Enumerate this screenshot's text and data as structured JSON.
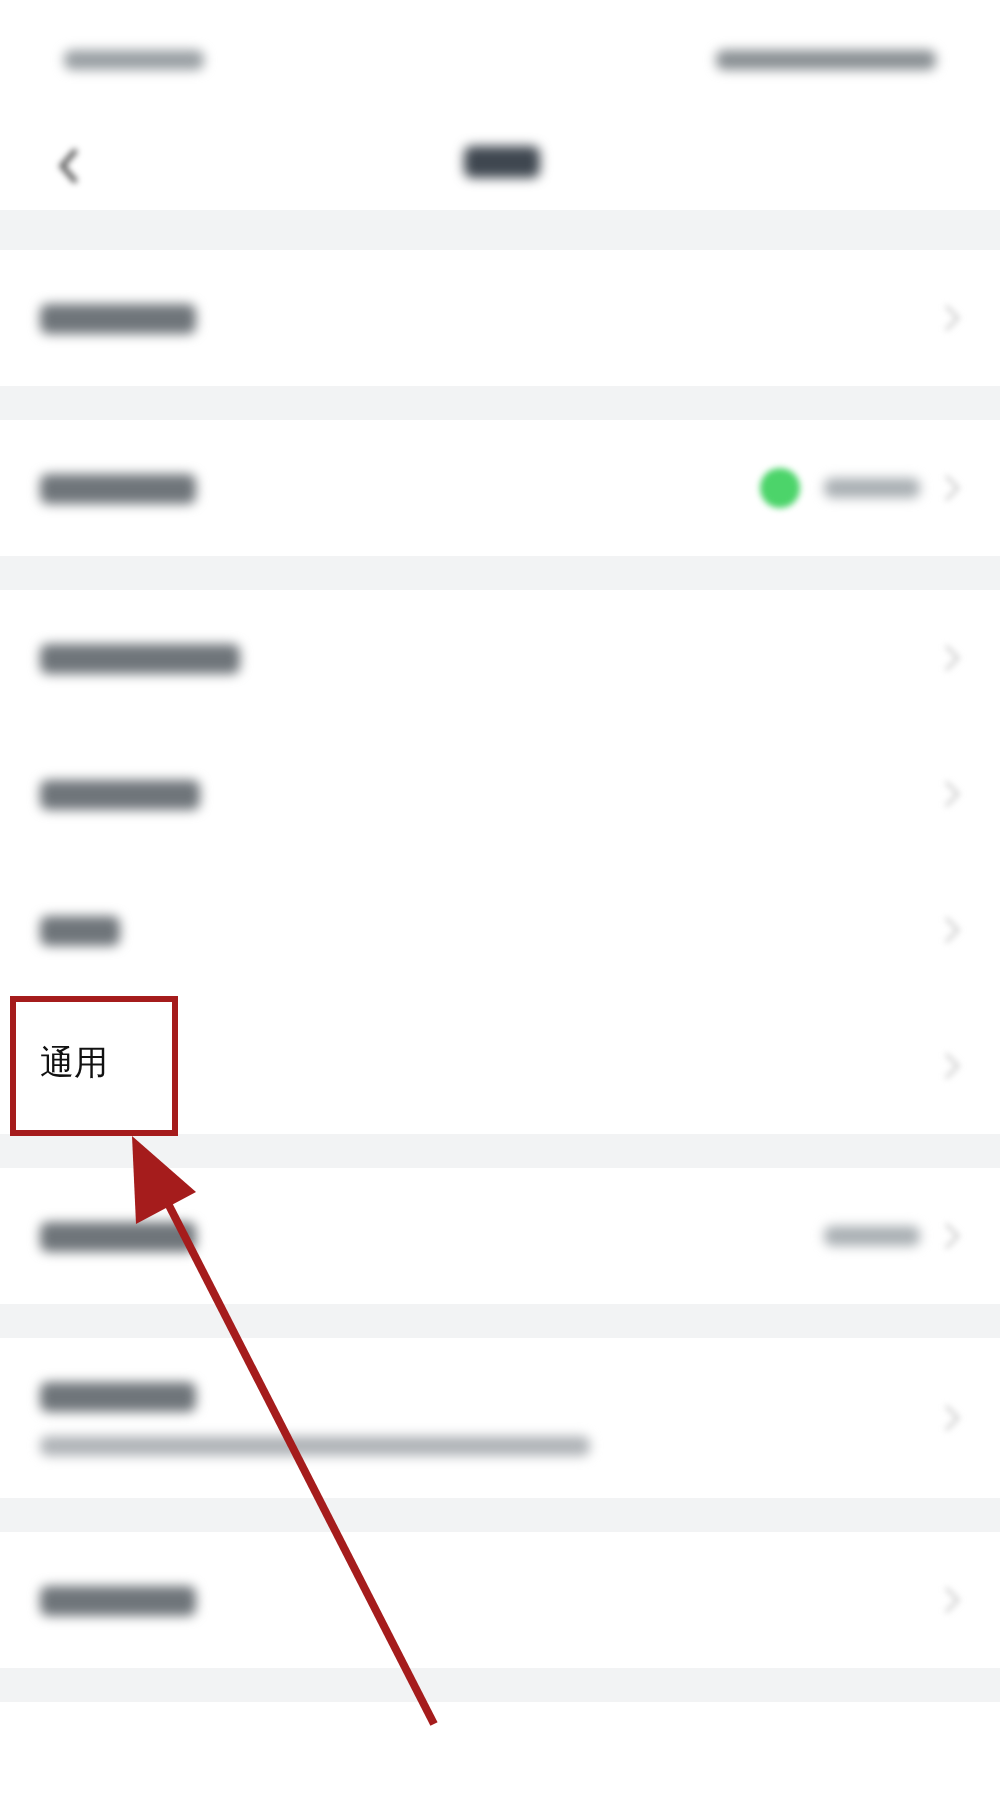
{
  "sections": [
    {
      "rows": [
        {
          "kind": "plain",
          "highlighted": false
        }
      ]
    },
    {
      "rows": [
        {
          "kind": "status",
          "highlighted": false
        }
      ]
    },
    {
      "rows": [
        {
          "kind": "plain",
          "highlighted": false
        },
        {
          "kind": "plain",
          "highlighted": false
        },
        {
          "kind": "plain",
          "highlighted": false
        },
        {
          "kind": "label",
          "label": "通用",
          "highlighted": true
        }
      ]
    },
    {
      "rows": [
        {
          "kind": "value",
          "highlighted": false
        }
      ]
    },
    {
      "rows": [
        {
          "kind": "subtitle",
          "highlighted": false
        }
      ]
    },
    {
      "rows": [
        {
          "kind": "plain",
          "highlighted": false
        }
      ]
    }
  ],
  "annotation": {
    "arrow": true
  }
}
